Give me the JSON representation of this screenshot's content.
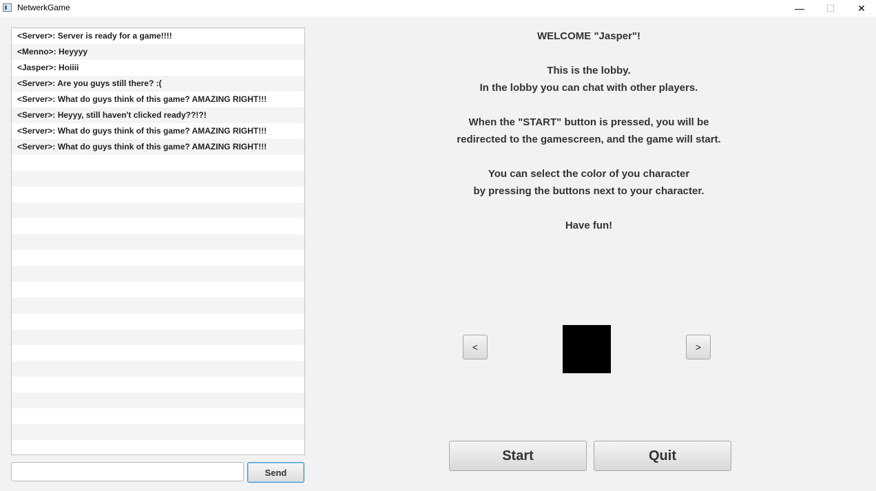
{
  "window": {
    "title": "NetwerkGame",
    "minimize": "—",
    "maximize": "☐",
    "close": "✕"
  },
  "chat": {
    "messages": [
      "<Server>: Server is ready for a game!!!!",
      "<Menno>: Heyyyy",
      "<Jasper>: Hoiiii",
      "<Server>: Are you guys still there? :(",
      "<Server>: What do guys think of this game? AMAZING RIGHT!!!",
      "<Server>: Heyyy, still haven't clicked ready??!?!",
      "<Server>: What do guys think of this game? AMAZING RIGHT!!!",
      "<Server>: What do guys think of this game? AMAZING RIGHT!!!"
    ],
    "empty_rows": 19,
    "input_value": "",
    "send_label": "Send"
  },
  "lobby": {
    "welcome": "WELCOME \"Jasper\"!",
    "lines": [
      "This is the lobby.",
      "In the lobby you can chat with other players.",
      "",
      "When the \"START\" button is pressed, you will be",
      "redirected to the gamescreen, and the game will start.",
      "",
      "You can select the color of you character",
      "by pressing the buttons next to your character.",
      "",
      "Have fun!"
    ]
  },
  "character": {
    "prev_label": "<",
    "next_label": ">",
    "color": "#000000"
  },
  "actions": {
    "start_label": "Start",
    "quit_label": "Quit"
  }
}
